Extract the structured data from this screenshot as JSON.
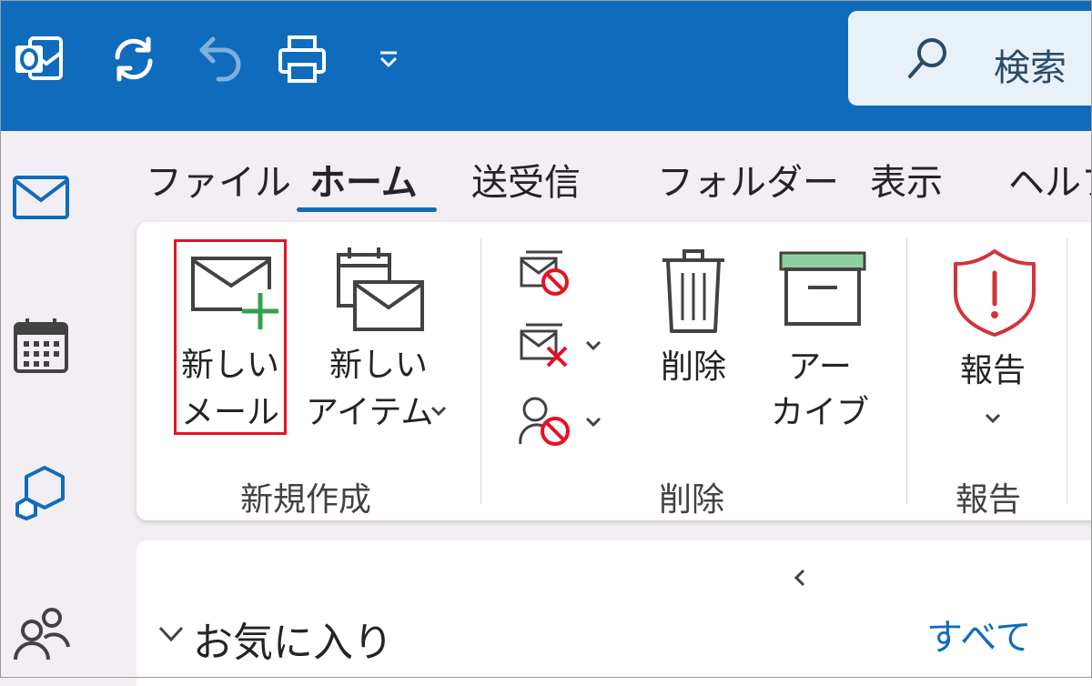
{
  "titlebar": {
    "icons": [
      "outlook-logo-icon",
      "sync-icon",
      "undo-icon",
      "print-icon",
      "customize-toolbar-icon"
    ],
    "search_label": "検索"
  },
  "rail": {
    "items": [
      "mail-icon",
      "calendar-icon",
      "apps-icon",
      "people-icon"
    ]
  },
  "tabs": [
    "ファイル",
    "ホーム",
    "送受信",
    "フォルダー",
    "表示",
    "ヘルプ"
  ],
  "active_tab": "ホーム",
  "ribbon": {
    "new_group": {
      "label": "新規作成",
      "new_mail": [
        "新しい",
        "メール"
      ],
      "new_item": [
        "新しい",
        "アイテム"
      ]
    },
    "delete_group": {
      "label": "削除",
      "small_buttons": [
        "ignore-icon",
        "cleanup-icon",
        "block-sender-icon"
      ],
      "delete_label": "削除",
      "archive": [
        "アー",
        "カイブ"
      ]
    },
    "report_group": {
      "label": "報告",
      "report_label": "報告"
    }
  },
  "folders": {
    "favorites_label": "お気に入り"
  },
  "message_list": {
    "filter_all": "すべて"
  },
  "colors": {
    "accent": "#0f6cbd",
    "highlight": "#e81123",
    "new_plus": "#31a24c",
    "archive_top": "#8fd19e",
    "report": "#d13438"
  }
}
